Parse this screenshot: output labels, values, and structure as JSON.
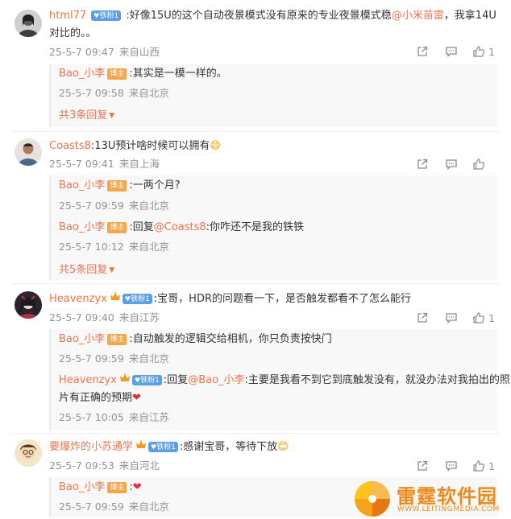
{
  "comments": [
    {
      "user": "html77",
      "fans_badge": "铁粉1",
      "text": ":好像15U的这个自动夜景模式没有原来的专业夜景模式稳",
      "mention": "@小米苗雷",
      "text_after": "，我拿14U",
      "text_line2": "对比的。。",
      "date": "25-5-7 09:47",
      "location": "来自山西",
      "likes": "1",
      "replies": [
        {
          "user": "Bao_小李",
          "host_badge": "博主",
          "text": ":其实是一模一样的。",
          "date": "25-5-7 09:58",
          "location": "来自北京"
        }
      ],
      "more": "共3条回复"
    },
    {
      "user": "Coasts8",
      "text": ":13U预计啥时候可以拥有",
      "emoji": "😄",
      "date": "25-5-7 09:41",
      "location": "来自上海",
      "likes": "",
      "replies": [
        {
          "user": "Bao_小李",
          "host_badge": "博主",
          "text": ":一两个月?",
          "date": "25-5-7 09:59",
          "location": "来自北京"
        },
        {
          "user": "Bao_小李",
          "host_badge": "博主",
          "text_prefix": ":回复",
          "mention": "@Coasts8",
          "text": ":你咋还不是我的铁铁",
          "date": "25-5-7 10:12",
          "location": "来自北京"
        }
      ],
      "more": "共5条回复"
    },
    {
      "user": "Heavenzyx",
      "fans_badge": "铁粉1",
      "text": ":宝哥，HDR的问题看一下，是否触发都看不了怎么能行",
      "date": "25-5-7 09:40",
      "location": "来自江苏",
      "likes": "1",
      "replies": [
        {
          "user": "Bao_小李",
          "host_badge": "博主",
          "text": ":自动触发的逻辑交给相机，你只负责按快门",
          "date": "25-5-7 09:59",
          "location": "来自北京"
        },
        {
          "user": "Heavenzyx",
          "fans_badge": "铁粉1",
          "text_prefix": ":回复",
          "mention": "@Bao_小李",
          "text": ":主要是我看不到它到底触发没有，就没办法对我拍出的照",
          "text_line2": "片有正确的预期",
          "emoji": "❤",
          "date": "25-5-7 10:05",
          "location": "来自江苏"
        }
      ]
    },
    {
      "user": "要爆炸的小苏通学",
      "fans_badge": "铁粉1",
      "text": ":感谢宝哥，等待下放",
      "emoji": "😊",
      "date": "25-5-7 09:53",
      "location": "来自河北",
      "likes": "1",
      "replies": [
        {
          "user": "Bao_小李",
          "host_badge": "博主",
          "text": ":",
          "emoji": "❤",
          "date": "25-5-7 09:59",
          "location": "来自北京"
        }
      ]
    }
  ],
  "watermark": {
    "title": "雷霆软件园",
    "url": "WWW.LEITINGMEDIA.COM"
  },
  "colors": {
    "username": "#eb7350",
    "meta": "#939393",
    "fans_badge": "#5b9fe6",
    "host_badge": "#f4a64a",
    "reply_bg": "#f8f8f8"
  },
  "icons": [
    "share-icon",
    "comment-icon",
    "thumbs-up-icon",
    "caret-down-icon",
    "crown-icon"
  ]
}
